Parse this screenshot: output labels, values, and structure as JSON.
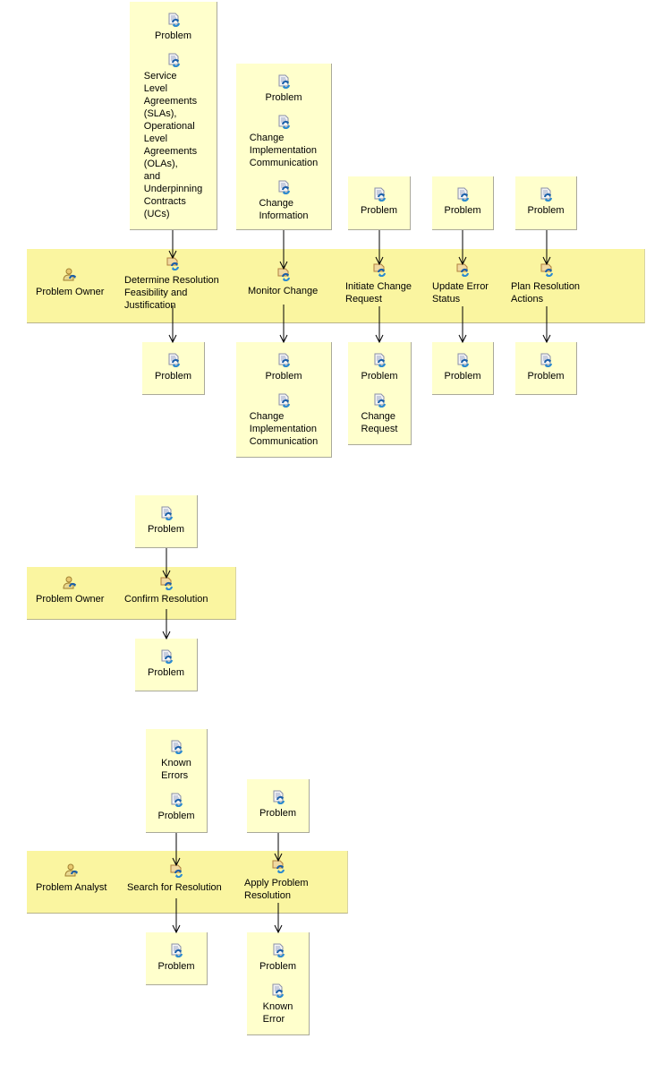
{
  "colors": {
    "lane": "#faf5a0",
    "box": "#ffffcc",
    "arrow": "#000000"
  },
  "diagrams": [
    {
      "role": {
        "label": "Problem Owner",
        "icon": "role-icon"
      },
      "tasks": [
        {
          "label": "Determine Resolution\nFeasibility and\nJustification",
          "inputs": [
            "Problem",
            "Service\nLevel\nAgreements\n(SLAs),\nOperational\nLevel\nAgreements\n(OLAs),\nand\nUnderpinning\nContracts\n(UCs)"
          ],
          "outputs": [
            "Problem"
          ]
        },
        {
          "label": "Monitor Change",
          "inputs": [
            "Problem",
            "Change\nImplementation\nCommunication",
            "Change\nInformation"
          ],
          "outputs": [
            "Problem",
            "Change\nImplementation\nCommunication"
          ]
        },
        {
          "label": "Initiate Change\nRequest",
          "inputs": [
            "Problem"
          ],
          "outputs": [
            "Problem",
            "Change\nRequest"
          ]
        },
        {
          "label": "Update Error\nStatus",
          "inputs": [
            "Problem"
          ],
          "outputs": [
            "Problem"
          ]
        },
        {
          "label": "Plan Resolution\nActions",
          "inputs": [
            "Problem"
          ],
          "outputs": [
            "Problem"
          ]
        }
      ]
    },
    {
      "role": {
        "label": "Problem Owner",
        "icon": "role-icon"
      },
      "tasks": [
        {
          "label": "Confirm Resolution",
          "inputs": [
            "Problem"
          ],
          "outputs": [
            "Problem"
          ]
        }
      ]
    },
    {
      "role": {
        "label": "Problem Analyst",
        "icon": "role-icon"
      },
      "tasks": [
        {
          "label": "Search for Resolution",
          "inputs": [
            "Known\nErrors",
            "Problem"
          ],
          "outputs": [
            "Problem"
          ]
        },
        {
          "label": "Apply Problem\nResolution",
          "inputs": [
            "Problem"
          ],
          "outputs": [
            "Problem",
            "Known\nError"
          ]
        }
      ]
    }
  ]
}
